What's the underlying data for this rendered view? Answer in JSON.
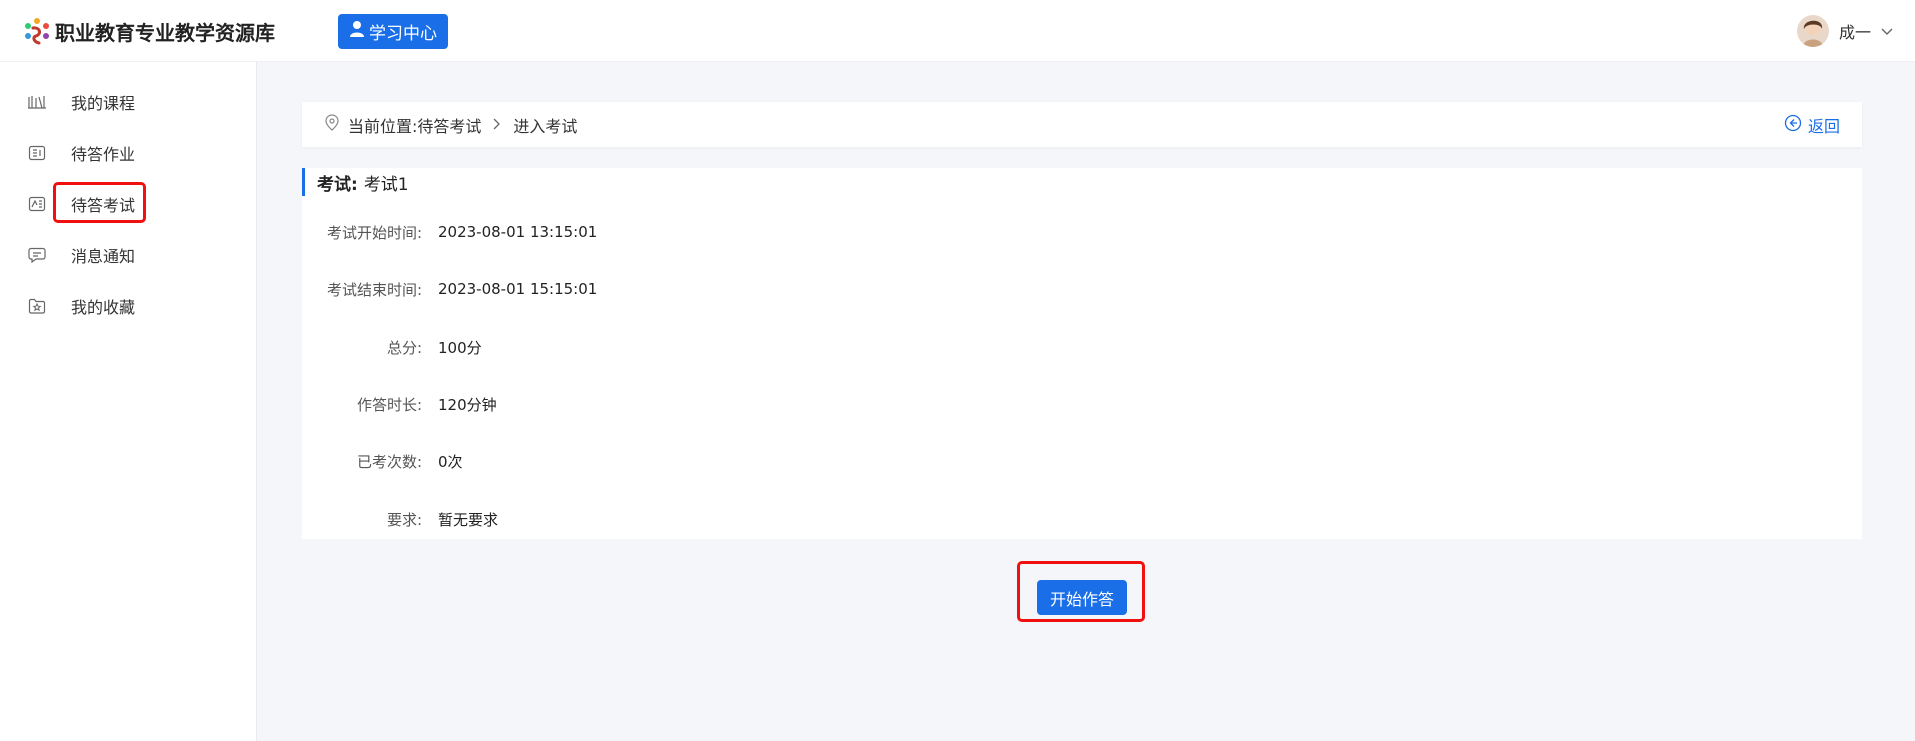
{
  "header": {
    "site_title": "职业教育专业教学资源库",
    "center_button": "学习中心",
    "user_name": "成一",
    "logo_icon": "colorful-flower-logo",
    "center_icon": "student-icon",
    "dropdown_icon": "chevron-down-icon"
  },
  "sidebar": {
    "items": [
      {
        "label": "我的课程",
        "icon": "books-icon"
      },
      {
        "label": "待答作业",
        "icon": "homework-icon"
      },
      {
        "label": "待答考试",
        "icon": "exam-icon"
      },
      {
        "label": "消息通知",
        "icon": "message-icon"
      },
      {
        "label": "我的收藏",
        "icon": "favorite-icon"
      }
    ]
  },
  "breadcrumb": {
    "prefix": "当前位置:",
    "parent": "待答考试",
    "current": "进入考试",
    "back_label": "返回"
  },
  "exam": {
    "title_label": "考试:",
    "title_value": "考试1",
    "fields": [
      {
        "key": "考试开始时间:",
        "value": "2023-08-01 13:15:01"
      },
      {
        "key": "考试结束时间:",
        "value": "2023-08-01 15:15:01"
      },
      {
        "key": "总分:",
        "value": "100分"
      },
      {
        "key": "作答时长:",
        "value": "120分钟"
      },
      {
        "key": "已考次数:",
        "value": "0次"
      },
      {
        "key": "要求:",
        "value": "暂无要求"
      }
    ]
  },
  "start_button": "开始作答",
  "colors": {
    "accent": "#1a6ee8",
    "highlight": "#f01010",
    "page_bg": "#f4f6fa"
  }
}
